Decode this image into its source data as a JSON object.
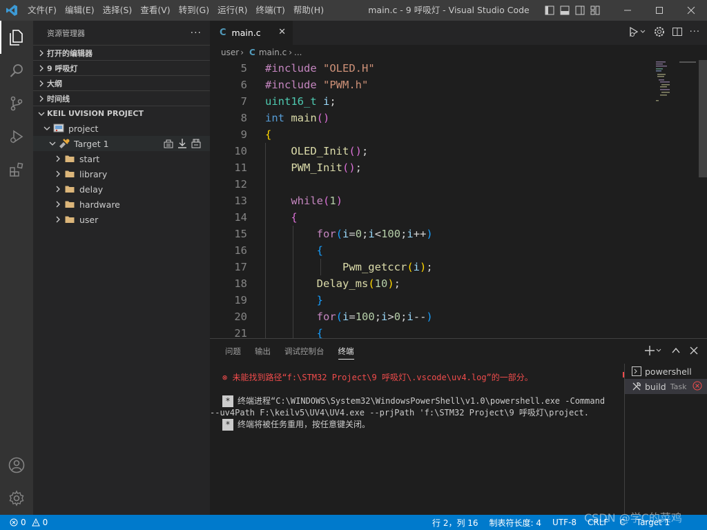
{
  "title_bar": {
    "menu": [
      "文件(F)",
      "编辑(E)",
      "选择(S)",
      "查看(V)",
      "转到(G)",
      "运行(R)",
      "终端(T)",
      "帮助(H)"
    ],
    "window_title": "main.c - 9 呼吸灯 - Visual Studio Code"
  },
  "sidebar": {
    "header": "资源管理器",
    "sections": {
      "open_editors": "打开的编辑器",
      "folder": "9 呼吸灯",
      "outline": "大纲",
      "timeline": "时间线",
      "keil": "KEIL UVISION PROJECT"
    },
    "tree": {
      "project": "project",
      "target": "Target 1",
      "folders": [
        "start",
        "library",
        "delay",
        "hardware",
        "user"
      ]
    }
  },
  "editor": {
    "tab_label": "main.c",
    "tab_icon": "C",
    "breadcrumb": [
      "user",
      "main.c",
      "..."
    ],
    "line_numbers": [
      "5",
      "6",
      "7",
      "8",
      "9",
      "10",
      "11",
      "12",
      "13",
      "14",
      "15",
      "16",
      "17",
      "18",
      "19",
      "20",
      "21"
    ],
    "code": {
      "l5": [
        "#include",
        "\"OLED.H\""
      ],
      "l6": [
        "#include",
        "\"PWM.h\""
      ],
      "l7": [
        "uint16_t",
        "i",
        ";"
      ],
      "l8": [
        "int",
        "main",
        "()"
      ],
      "l9": [
        "{"
      ],
      "l10": [
        "OLED_Init",
        "()",
        ";"
      ],
      "l11": [
        "PWM_Init",
        "()",
        ";"
      ],
      "l13": [
        "while",
        "(",
        "1",
        ")"
      ],
      "l14": [
        "{"
      ],
      "l15": [
        "for",
        "(",
        "i",
        "=",
        "0",
        ";",
        "i",
        "<",
        "100",
        ";",
        "i",
        "++",
        ")"
      ],
      "l16": [
        "{"
      ],
      "l17": [
        "Pwm_getccr",
        "(",
        "i",
        ")",
        ";"
      ],
      "l18": [
        "Delay_ms",
        "(",
        "10",
        ")",
        ";"
      ],
      "l19": [
        "}"
      ],
      "l20": [
        "for",
        "(",
        "i",
        "=",
        "100",
        ";",
        "i",
        ">",
        "0",
        ";",
        "i",
        "--",
        ")"
      ],
      "l21": [
        "{"
      ]
    }
  },
  "panel": {
    "tabs": [
      "问题",
      "输出",
      "调试控制台",
      "终端"
    ],
    "active_tab": "终端",
    "terminal": {
      "error": "未能找到路径“f:\\STM32 Project\\9 呼吸灯\\.vscode\\uv4.log”的一部分。",
      "star": "*",
      "line1": "终端进程“C:\\WINDOWS\\System32\\WindowsPowerShell\\v1.0\\powershell.exe -Command",
      "line2": "--uv4Path F:\\keilv5\\UV4\\UV4.exe --prjPath 'f:\\STM32 Project\\9    呼吸灯\\project.",
      "line3": "终端将被任务重用，按任意键关闭。"
    },
    "terminal_list": [
      {
        "label": "powershell",
        "tag": ""
      },
      {
        "label": "build",
        "tag": "Task"
      }
    ]
  },
  "status_bar": {
    "errors": "0",
    "warnings": "0",
    "position": "行 2，列 16",
    "tab_size": "制表符长度: 4",
    "encoding": "UTF-8",
    "eol": "CRLF",
    "language": "C",
    "target": "Target 1"
  },
  "watermark": "CSDN @学C的菜鸡",
  "colors": {
    "accent": "#007acc",
    "error": "#f14c4c",
    "keyword": "#569cd6",
    "preprocessor": "#c586c0",
    "string": "#ce9178",
    "function": "#dcdcaa",
    "type": "#4ec9b0",
    "variable": "#9cdcfe",
    "number": "#b5cea8"
  },
  "icons": [
    "vscode-logo-icon",
    "explorer-icon",
    "search-icon",
    "source-control-icon",
    "run-debug-icon",
    "extensions-icon",
    "account-icon",
    "settings-gear-icon",
    "folder-icon",
    "target-icon",
    "project-icon"
  ]
}
